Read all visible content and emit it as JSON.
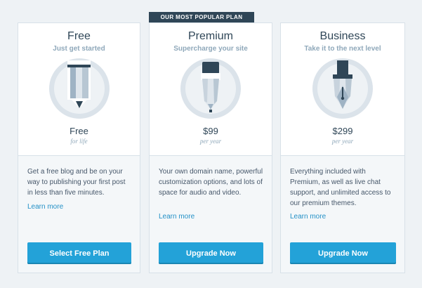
{
  "banner": {
    "popular_label": "OUR MOST POPULAR PLAN"
  },
  "plans": {
    "free": {
      "name": "Free",
      "tagline": "Just get started",
      "price": "Free",
      "period": "for life",
      "description": "Get a free blog and be on your way to publishing your first post in less than five minutes.",
      "learn_more": "Learn more",
      "button_label": "Select Free Plan",
      "icon": "pencil-icon"
    },
    "premium": {
      "name": "Premium",
      "tagline": "Supercharge your site",
      "price": "$99",
      "period": "per year",
      "description": "Your own domain name, powerful customization options, and lots of space for audio and video.",
      "learn_more": "Learn more",
      "button_label": "Upgrade Now",
      "icon": "marker-icon"
    },
    "business": {
      "name": "Business",
      "tagline": "Take it to the next level",
      "price": "$299",
      "period": "per year",
      "description": "Everything included with Premium, as well as live chat support, and unlimited access to our premium themes.",
      "learn_more": "Learn more",
      "button_label": "Upgrade Now",
      "icon": "fountain-pen-icon"
    }
  },
  "colors": {
    "accent": "#23a2d8",
    "title": "#2f4657",
    "muted": "#8fa8ba",
    "banner": "#2f4657",
    "link": "#2491c7"
  }
}
